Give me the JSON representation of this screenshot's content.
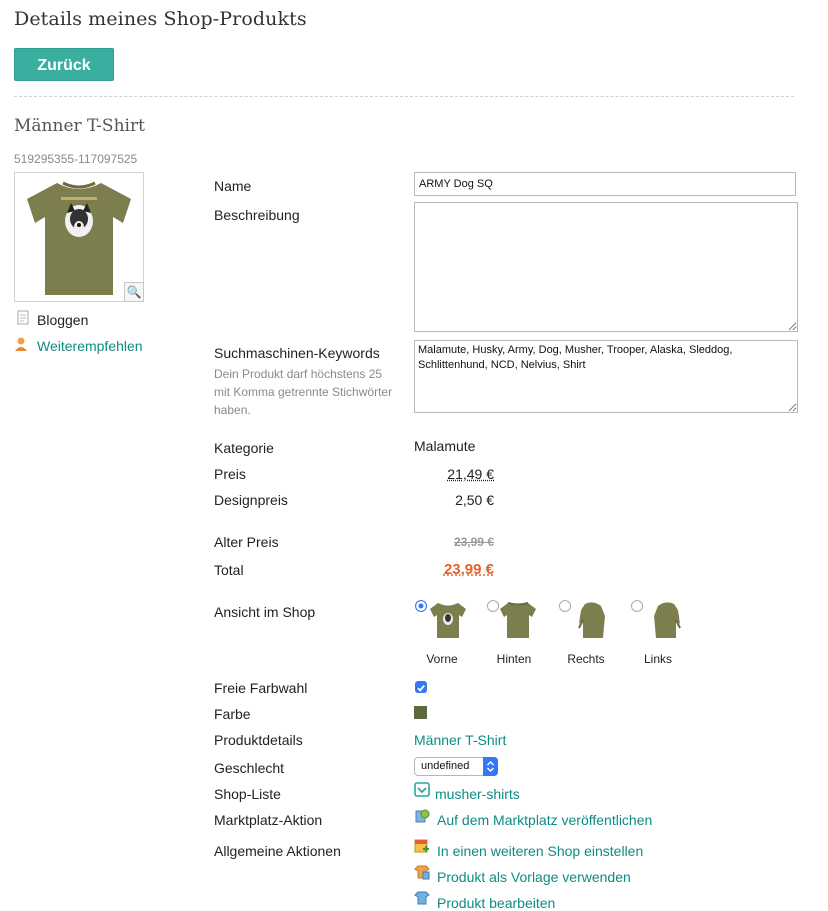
{
  "page": {
    "title": "Details meines Shop-Produkts",
    "back_label": "Zurück"
  },
  "product": {
    "type_name": "Männer T-Shirt",
    "id": "519295355-117097525"
  },
  "sidebar": {
    "blog_label": "Bloggen",
    "recommend_label": "Weiterempfehlen"
  },
  "form": {
    "name_label": "Name",
    "name_value": "ARMY Dog SQ",
    "description_label": "Beschreibung",
    "description_value": "",
    "keywords_label": "Suchmaschinen-Keywords",
    "keywords_hint": "Dein Produkt darf höchstens 25 mit Komma getrennte Stichwörter haben.",
    "keywords_value": "Malamute, Husky, Army, Dog, Musher, Trooper, Alaska, Sleddog, Schlittenhund, NCD, Nelvius, Shirt",
    "category_label": "Kategorie",
    "category_value": "Malamute",
    "price_label": "Preis",
    "price_value": "21,49 €",
    "designprice_label": "Designpreis",
    "designprice_value": "2,50 €",
    "oldprice_label": "Alter Preis",
    "oldprice_value": "23,99 €",
    "total_label": "Total",
    "total_value": "23,99 €",
    "view_label": "Ansicht im Shop",
    "views": [
      {
        "label": "Vorne",
        "selected": true
      },
      {
        "label": "Hinten",
        "selected": false
      },
      {
        "label": "Rechts",
        "selected": false
      },
      {
        "label": "Links",
        "selected": false
      }
    ],
    "free_color_label": "Freie Farbwahl",
    "free_color_checked": true,
    "color_label": "Farbe",
    "color_value": "#5f6a3c",
    "details_label": "Produktdetails",
    "details_link": "Männer T-Shirt",
    "gender_label": "Geschlecht",
    "gender_value": "undefined",
    "shoplist_label": "Shop-Liste",
    "shoplist_link": "musher-shirts",
    "market_label": "Marktplatz-Aktion",
    "market_link": "Auf dem Marktplatz veröffentlichen",
    "general_label": "Allgemeine Aktionen",
    "actions": [
      "In einen weiteren Shop einstellen",
      "Produkt als Vorlage verwenden",
      "Produkt bearbeiten"
    ]
  },
  "colors": {
    "accent": "#3aaf9f",
    "link": "#0f8b83",
    "total": "#e8612a",
    "shirt": "#7d7e4d"
  }
}
